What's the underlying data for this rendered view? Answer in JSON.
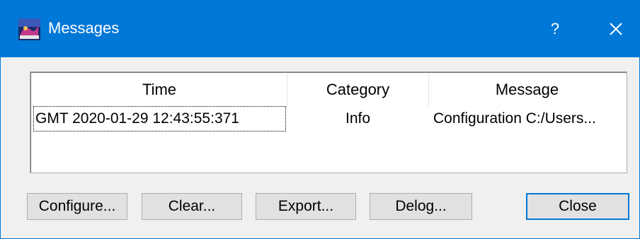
{
  "window": {
    "title": "Messages",
    "help_label": "?",
    "accent_color": "#0078d7"
  },
  "table": {
    "columns": [
      "Time",
      "Category",
      "Message"
    ],
    "rows": [
      {
        "time": "GMT 2020-01-29 12:43:55:371",
        "category": "Info",
        "message": "Configuration C:/Users..."
      }
    ]
  },
  "buttons": {
    "configure": "Configure...",
    "clear": "Clear...",
    "export": "Export...",
    "delog": "Delog...",
    "close": "Close"
  },
  "icons": {
    "app": "app-logo-icon",
    "close": "close-icon"
  }
}
